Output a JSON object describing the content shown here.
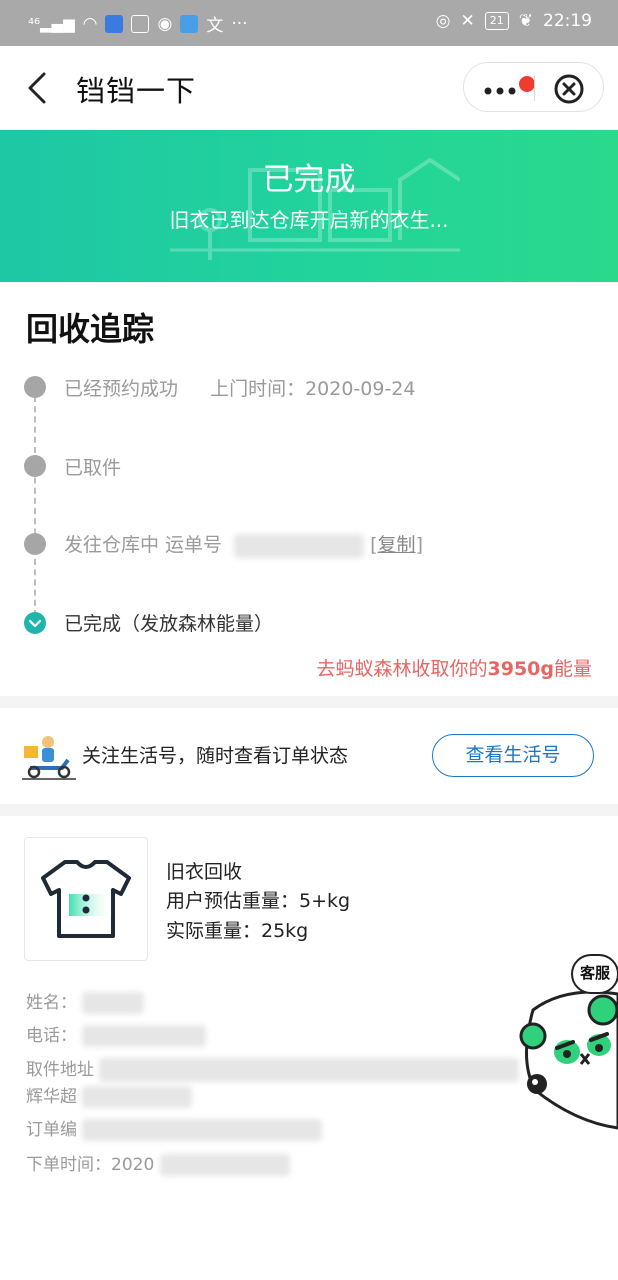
{
  "status_bar": {
    "time": "22:19",
    "battery": "21"
  },
  "header": {
    "title": "铛铛一下"
  },
  "banner": {
    "status": "已完成",
    "subtitle": "旧衣已到达仓库开启新的衣生..."
  },
  "tracking": {
    "title": "回收追踪",
    "steps": [
      {
        "label": "已经预约成功",
        "extra": "上门时间：2020-09-24"
      },
      {
        "label": "已取件"
      },
      {
        "label": "发往仓库中 运单号",
        "copy_label": "复制"
      },
      {
        "label": "已完成（发放森林能量）"
      }
    ],
    "energy_prefix": "去蚂蚁森林收取你的",
    "energy_amount": "3950g",
    "energy_suffix": "能量"
  },
  "follow": {
    "text": "关注生活号，随时查看订单状态",
    "button_label": "查看生活号"
  },
  "product": {
    "name": "旧衣回收",
    "estimated_weight": "用户预估重量：5+kg",
    "actual_weight": "实际重量：25kg"
  },
  "order_info": {
    "name_label": "姓名：",
    "phone_label": "电话：",
    "address_label": "取件地址",
    "address_line2_prefix": "辉华超",
    "order_no_label": "订单编",
    "order_time_label": "下单时间：",
    "order_time_visible": "2020"
  },
  "customer_service": {
    "label": "客服"
  },
  "colors": {
    "banner_start": "#1ec7a5",
    "banner_end": "#2ad98c",
    "accent_teal": "#1fb5ad",
    "energy_red": "#e96563",
    "link_blue": "#1a78c8"
  }
}
